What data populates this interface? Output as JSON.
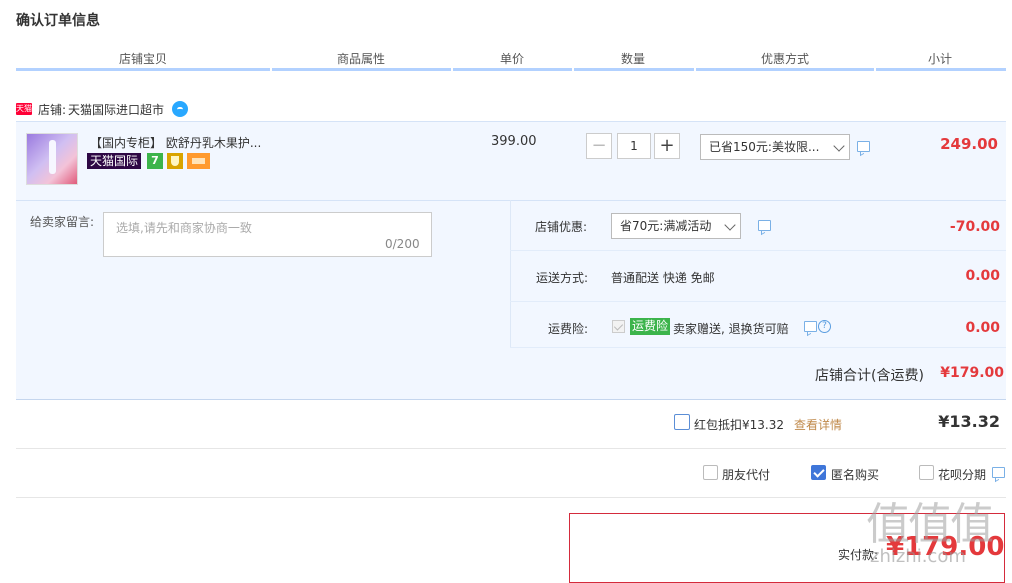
{
  "page_title": "确认订单信息",
  "columns": [
    "店铺宝贝",
    "商品属性",
    "单价",
    "数量",
    "优惠方式",
    "小计"
  ],
  "shop": {
    "badge": "天猫",
    "label": "店铺:",
    "name": "天猫国际进口超市",
    "icon": "wangwang-chat-icon"
  },
  "item": {
    "title": "【国内专柜】 欧舒丹乳木果护...",
    "tag_tmall": "天猫国际",
    "tag_7": "7",
    "unit_price": "399.00",
    "quantity": "1",
    "minus": "−",
    "plus": "+",
    "discount": "已省150元:美妆限...",
    "subtotal": "249.00"
  },
  "message": {
    "label": "给卖家留言:",
    "placeholder": "选填,请先和商家协商一致",
    "count": "0/200"
  },
  "shop_discount": {
    "label": "店铺优惠:",
    "value": "省70元:满减活动",
    "amount": "-70.00"
  },
  "shipping": {
    "label": "运送方式:",
    "value": "普通配送 快递 免邮",
    "amount": "0.00"
  },
  "insurance": {
    "label": "运费险:",
    "badge": "运费险",
    "text": "卖家赠送, 退换货可赔",
    "amount": "0.00"
  },
  "shop_total": {
    "label": "店铺合计(含运费)",
    "value": "¥179.00"
  },
  "red_packet": {
    "label": "红包抵扣¥13.32",
    "link": "查看详情",
    "value": "¥13.32"
  },
  "options": {
    "friend_pay": "朋友代付",
    "anonymous": "匿名购买",
    "anonymous_checked": true,
    "huabei": "花呗分期"
  },
  "payment": {
    "label": "实付款:",
    "value": "¥179.00"
  },
  "watermark": {
    "big": "值值值",
    "small": "zhizhi.com"
  },
  "colors": {
    "accent_red": "#e4393c",
    "header_line": "#b2d1ff",
    "panel_bg": "#f2f7ff"
  }
}
